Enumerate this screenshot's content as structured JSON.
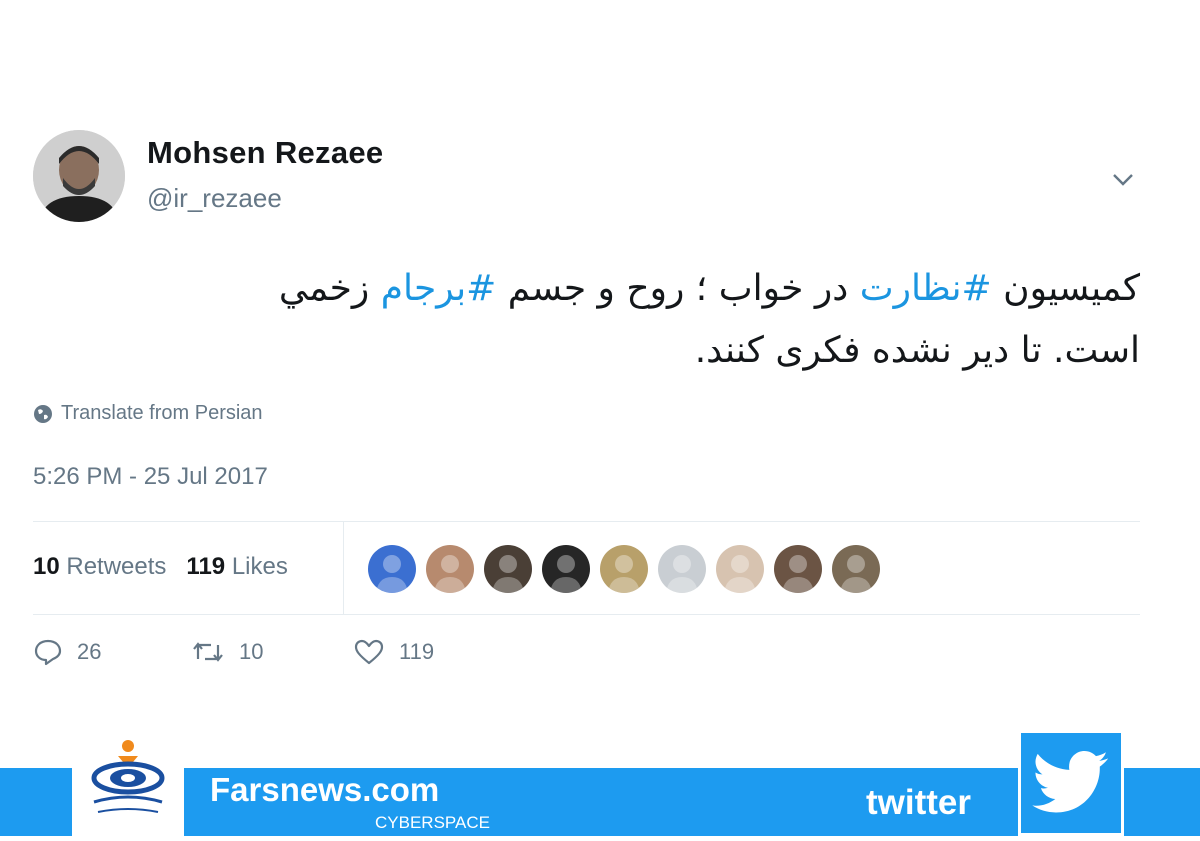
{
  "author": {
    "name": "Mohsen Rezaee",
    "handle": "@ir_rezaee"
  },
  "tweet": {
    "line1_part1": "کمیسیون ",
    "hashtag1": "#نظارت",
    "line1_part2": " در خواب ؛ روح و جسم ",
    "hashtag2": "#برجام",
    "line1_part3": " زخمي",
    "line2": "است. تا دیر نشده  فکری کنند.",
    "translate_label": "Translate from Persian",
    "timestamp": "5:26 PM - 25 Jul 2017"
  },
  "stats": {
    "retweets_count": "10",
    "retweets_label": "Retweets",
    "likes_count": "119",
    "likes_label": "Likes",
    "likers_colors": [
      "#3b6fd1",
      "#b78a6e",
      "#4a3f36",
      "#262626",
      "#b8a06a",
      "#c9ced3",
      "#d7c3b0",
      "#6b5444",
      "#7a6a55"
    ]
  },
  "actions": {
    "reply_count": "26",
    "retweet_count": "10",
    "like_count": "119"
  },
  "banner": {
    "site": "Farsnews.com",
    "section": "CYBERSPACE",
    "brand": "twitter",
    "accent": "#1d9bf0"
  },
  "icons": [
    "globe-icon",
    "chevron-down-icon",
    "reply-icon",
    "retweet-icon",
    "heart-icon",
    "twitter-bird-icon",
    "fars-logo"
  ]
}
